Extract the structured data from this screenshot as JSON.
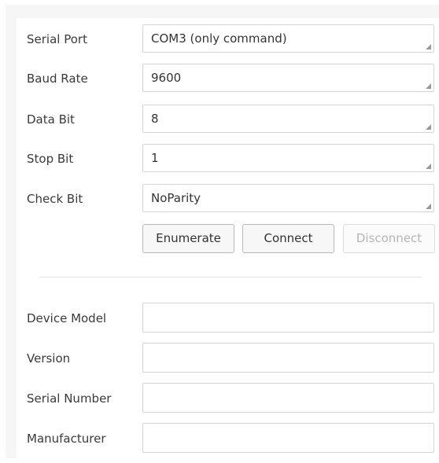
{
  "serial_config": {
    "serial_port": {
      "label": "Serial Port",
      "value": "COM3 (only command)"
    },
    "baud_rate": {
      "label": "Baud Rate",
      "value": "9600"
    },
    "data_bit": {
      "label": "Data Bit",
      "value": "8"
    },
    "stop_bit": {
      "label": "Stop Bit",
      "value": "1"
    },
    "check_bit": {
      "label": "Check Bit",
      "value": "NoParity"
    }
  },
  "buttons": {
    "enumerate": "Enumerate",
    "connect": "Connect",
    "disconnect": "Disconnect"
  },
  "device_info": {
    "device_model": {
      "label": "Device Model",
      "value": ""
    },
    "version": {
      "label": "Version",
      "value": ""
    },
    "serial_number": {
      "label": "Serial Number",
      "value": ""
    },
    "manufacturer": {
      "label": "Manufacturer",
      "value": ""
    }
  },
  "colors": {
    "panel_background": "#f6f6f6",
    "field_border": "#d4d4d4",
    "disabled_text": "#b5b5b5"
  }
}
